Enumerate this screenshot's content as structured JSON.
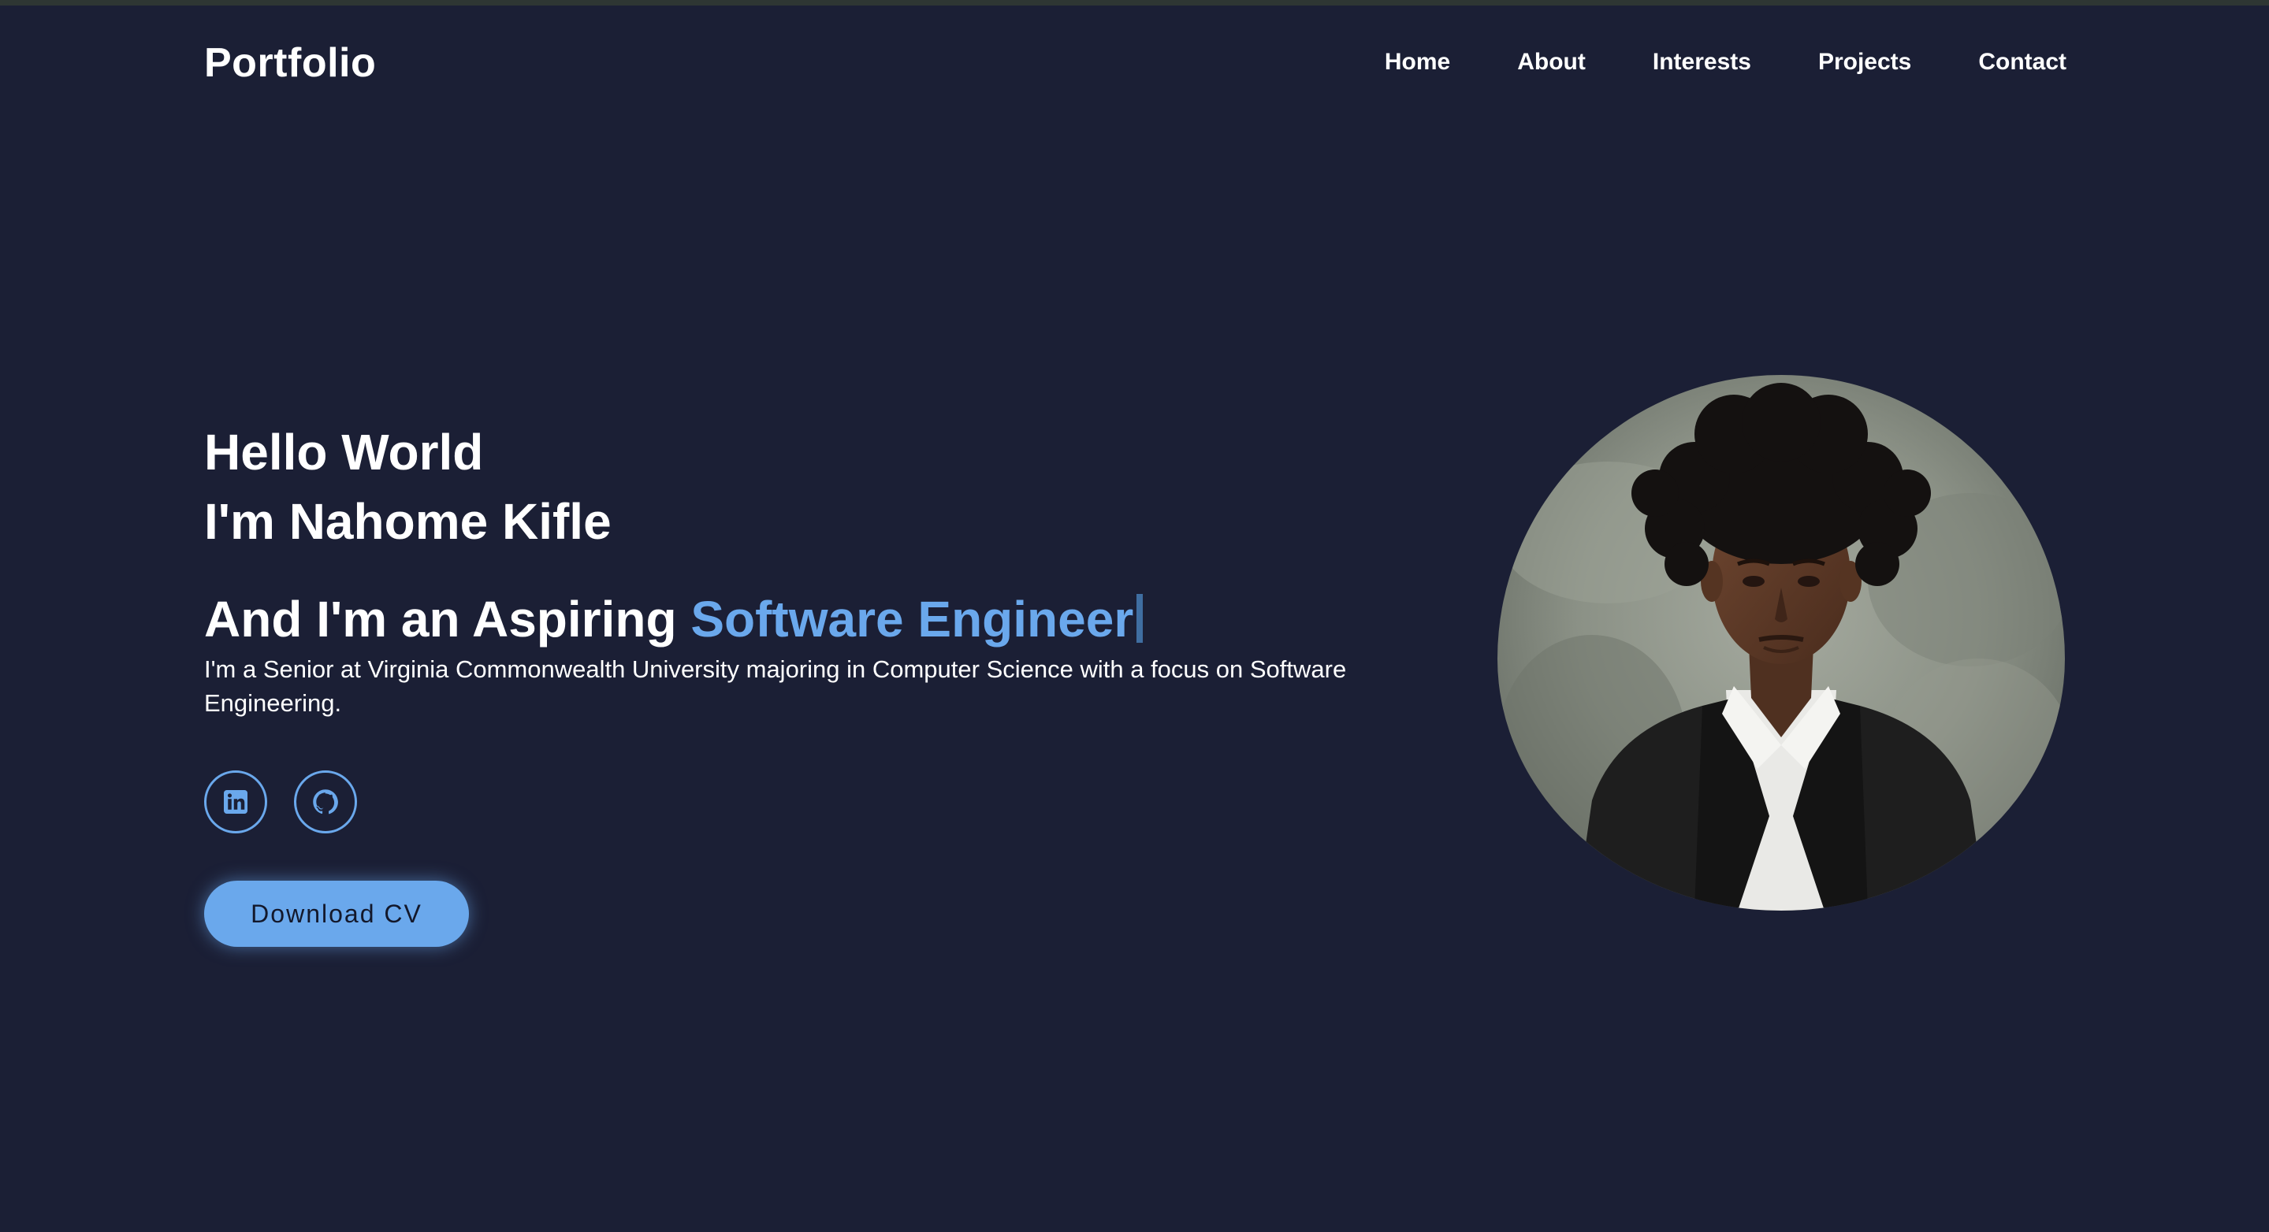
{
  "header": {
    "logo": "Portfolio",
    "nav": [
      "Home",
      "About",
      "Interests",
      "Projects",
      "Contact"
    ]
  },
  "hero": {
    "greeting_line1": "Hello World",
    "greeting_line2": "I'm Nahome Kifle",
    "role_prefix": "And I'm an Aspiring ",
    "role_highlight": "Software Engineer",
    "bio": "I'm a Senior at Virginia Commonwealth University majoring in Computer Science with a focus on Software Engineering.",
    "cv_button": "Download CV",
    "socials": [
      "linkedin-icon",
      "github-icon"
    ]
  },
  "colors": {
    "background": "#1b1f35",
    "accent": "#6aa8ec",
    "text": "#ffffff"
  }
}
